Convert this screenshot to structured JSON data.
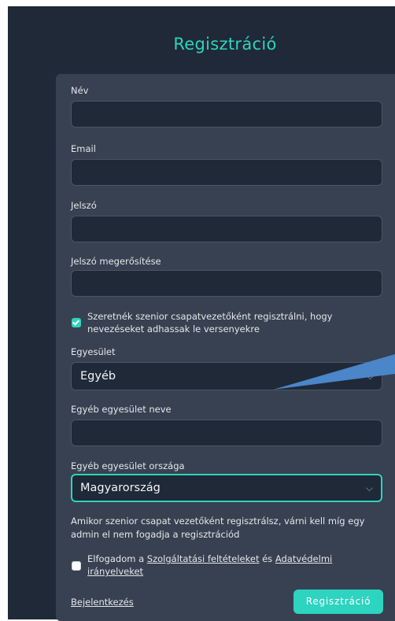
{
  "title": "Regisztráció",
  "fields": {
    "name_label": "Név",
    "email_label": "Email",
    "password_label": "Jelszó",
    "password_confirm_label": "Jelszó megerősítése"
  },
  "senior_checkbox": {
    "checked": true,
    "label": "Szeretnék szenior csapatvezetőként regisztrálni, hogy nevezéseket adhassak le versenyekre"
  },
  "association": {
    "label": "Egyesület",
    "value": "Egyéb"
  },
  "other_association_name": {
    "label": "Egyéb egyesület neve"
  },
  "other_association_country": {
    "label": "Egyéb egyesület országa",
    "value": "Magyarország"
  },
  "note": "Amikor szenior csapat vezetőként regisztrálsz, várni kell míg egy admin el nem fogadja a regisztrációd",
  "terms": {
    "checked": false,
    "prefix": "Elfogadom a",
    "tos_link": "Szolgáltatási feltételeket",
    "and": "és",
    "privacy_link": "Adatvédelmi irányelveket"
  },
  "login_link": "Bejelentkezés",
  "submit_button": "Regisztráció",
  "colors": {
    "accent": "#2dd4bf",
    "background": "#1f2937",
    "card": "#374151",
    "annotation_arrow": "#4a86c8"
  }
}
